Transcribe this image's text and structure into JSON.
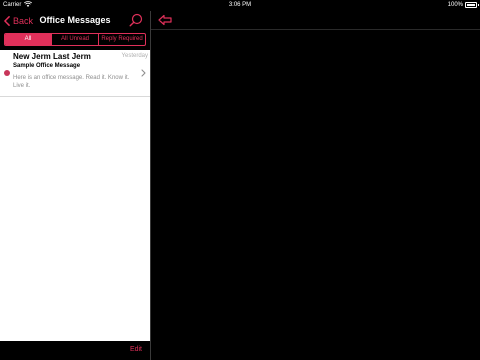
{
  "status_bar": {
    "carrier": "Carrier",
    "time": "3:06 PM",
    "battery": "100%",
    "battery_level": 1.0,
    "icons": [
      "wifi-icon",
      "battery-icon"
    ]
  },
  "master": {
    "nav": {
      "back_label": "Back",
      "title": "Office Messages",
      "icons": [
        "chevron-left-icon",
        "search-icon"
      ]
    },
    "filters": [
      {
        "label": "All",
        "active": true
      },
      {
        "label": "All Unread",
        "active": false
      },
      {
        "label": "Reply Required",
        "active": false
      }
    ],
    "messages": [
      {
        "sender": "New Jerm Last Jerm",
        "date": "Yesterday",
        "subject": "Sample Office Message",
        "preview": "Here is an office message.  Read it.  Know it.  Live it.",
        "unread": true
      }
    ],
    "toolbar": {
      "edit_label": "Edit"
    }
  },
  "detail": {
    "icons": [
      "expand-arrow-icon"
    ]
  },
  "colors": {
    "accent": "#e0305a",
    "unread_dot": "#c8365a",
    "list_background": "#ffffff",
    "chrome_background": "#000000",
    "secondary_text": "#8e8e8e"
  }
}
